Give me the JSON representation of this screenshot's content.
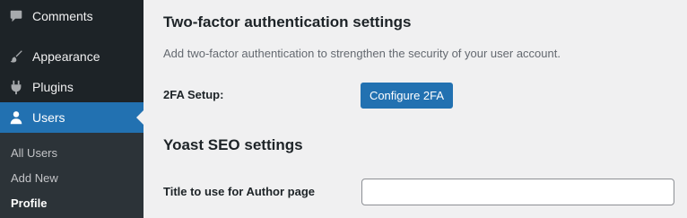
{
  "sidebar": {
    "items": [
      {
        "label": "Comments",
        "icon": "comment-icon"
      },
      {
        "label": "Appearance",
        "icon": "paintbrush-icon"
      },
      {
        "label": "Plugins",
        "icon": "plug-icon"
      },
      {
        "label": "Users",
        "icon": "user-icon",
        "active": true
      }
    ],
    "submenu": [
      {
        "label": "All Users"
      },
      {
        "label": "Add New"
      },
      {
        "label": "Profile",
        "current": true
      }
    ]
  },
  "two_factor": {
    "heading": "Two-factor authentication settings",
    "description": "Add two-factor authentication to strengthen the security of your user account.",
    "setup_label": "2FA Setup:",
    "configure_button": "Configure 2FA"
  },
  "yoast": {
    "heading": "Yoast SEO settings",
    "author_title_label": "Title to use for Author page",
    "author_title_value": ""
  },
  "colors": {
    "sidebar_bg": "#1d2327",
    "submenu_bg": "#2c3338",
    "accent": "#2271b1",
    "page_bg": "#f0f0f1"
  }
}
